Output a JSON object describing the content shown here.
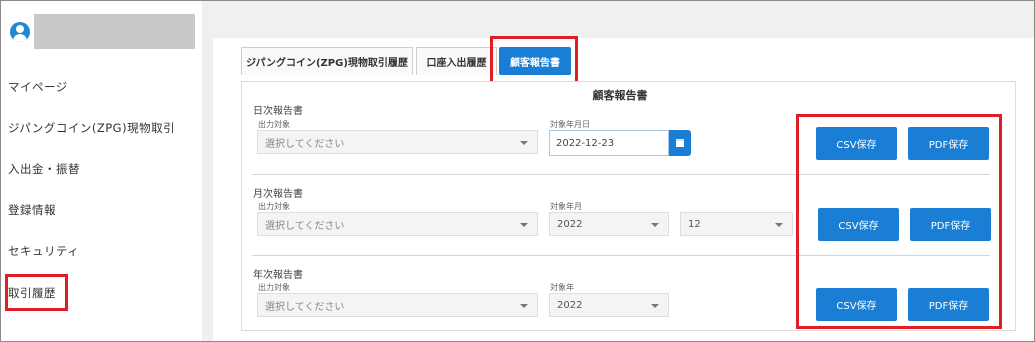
{
  "sidebar": {
    "items": [
      {
        "label": "マイページ"
      },
      {
        "label": "ジパングコイン(ZPG)現物取引"
      },
      {
        "label": "入出金・振替"
      },
      {
        "label": "登録情報"
      },
      {
        "label": "セキュリティ"
      },
      {
        "label": "取引履歴"
      }
    ],
    "active_item": "取引履歴"
  },
  "tabs": [
    {
      "label": "ジパングコイン(ZPG)現物取引履歴"
    },
    {
      "label": "口座入出履歴"
    },
    {
      "label": "顧客報告書"
    }
  ],
  "active_tab": "顧客報告書",
  "report": {
    "title": "顧客報告書",
    "daily": {
      "label": "日次報告書",
      "output_label": "出力対象",
      "output_placeholder": "選択してください",
      "date_label": "対象年月日",
      "date_value": "2022-12-23",
      "csv_label": "CSV保存",
      "pdf_label": "PDF保存"
    },
    "monthly": {
      "label": "月次報告書",
      "output_label": "出力対象",
      "output_placeholder": "選択してください",
      "period_label": "対象年月",
      "year_value": "2022",
      "month_value": "12",
      "csv_label": "CSV保存",
      "pdf_label": "PDF保存"
    },
    "yearly": {
      "label": "年次報告書",
      "output_label": "出力対象",
      "output_placeholder": "選択してください",
      "year_label": "対象年",
      "year_value": "2022",
      "csv_label": "CSV保存",
      "pdf_label": "PDF保存"
    }
  },
  "colors": {
    "accent": "#1a7fd4",
    "highlight": "#e01e25",
    "background": "#f0f0f0"
  }
}
